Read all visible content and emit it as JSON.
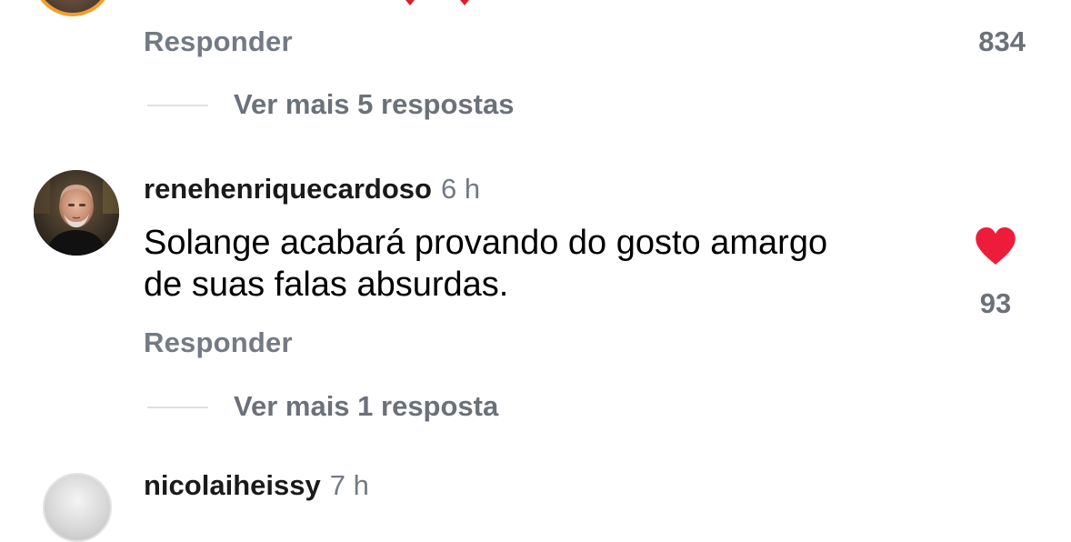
{
  "comments": {
    "top_partial": {
      "reply_label": "Responder",
      "like_count": "834",
      "more_replies": "Ver mais 5 respostas"
    },
    "main": {
      "username": "renehenriquecardoso",
      "time": "6 h",
      "text_line1": "Solange acabará provando do gosto amargo",
      "text_line2": "de suas falas absurdas.",
      "like_count": "93",
      "reply_label": "Responder",
      "more_replies": "Ver mais 1 resposta",
      "like_icon": "heart-filled-icon",
      "liked_color": "#ed1c3b"
    },
    "bottom_partial": {
      "username": "nicolaiheissy",
      "time": "7 h"
    }
  },
  "colors": {
    "secondary_text": "#737a84",
    "liked_heart": "#ed1c3b",
    "avatar_ring": "#f0a02b"
  }
}
